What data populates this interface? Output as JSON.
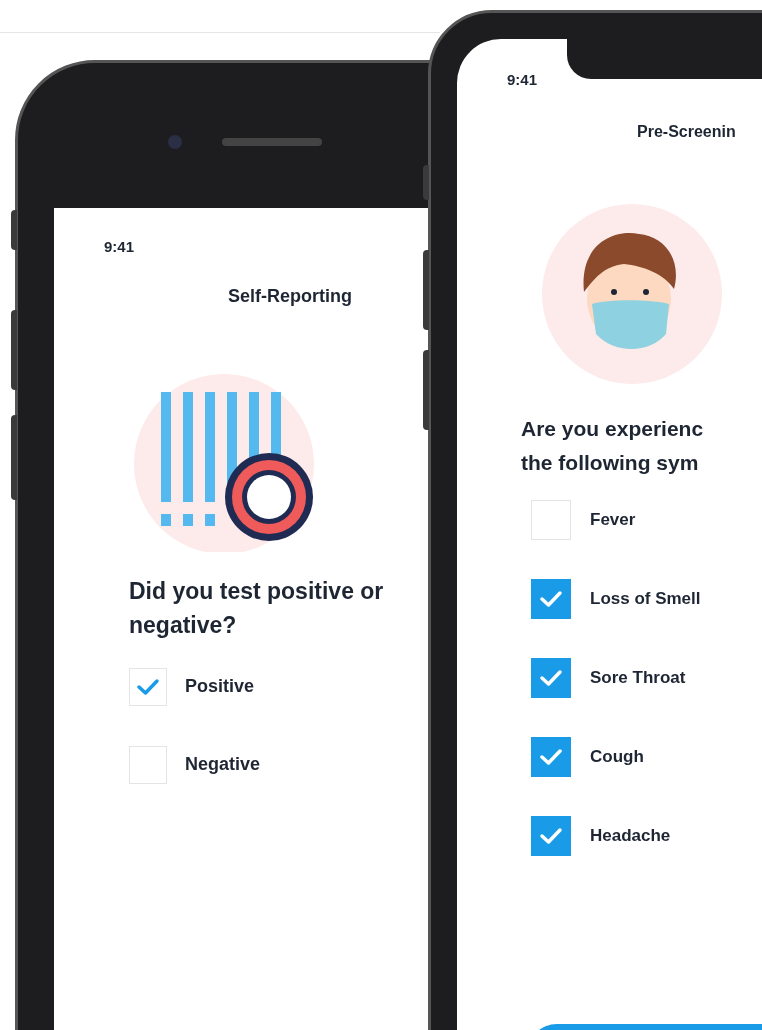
{
  "back_phone": {
    "time": "9:41",
    "title": "Self-Reporting",
    "question_lines": [
      "Did you test positive or",
      "negative?"
    ],
    "options": [
      {
        "label": "Positive",
        "checked": true
      },
      {
        "label": "Negative",
        "checked": false
      }
    ]
  },
  "front_phone": {
    "time": "9:41",
    "title": "Pre-Screenin",
    "question_lines": [
      "Are you experienc",
      "the following sym"
    ],
    "options": [
      {
        "label": "Fever",
        "checked": false
      },
      {
        "label": "Loss of Smell",
        "checked": true
      },
      {
        "label": "Sore Throat",
        "checked": true
      },
      {
        "label": "Cough",
        "checked": true
      },
      {
        "label": "Headache",
        "checked": true
      }
    ]
  }
}
